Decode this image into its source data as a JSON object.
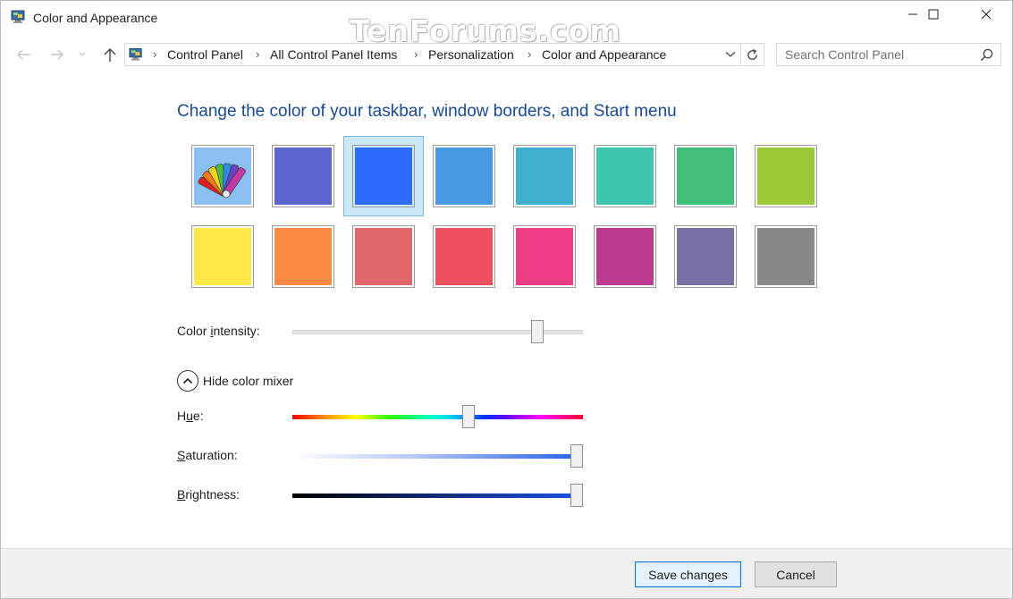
{
  "window": {
    "title": "Color and Appearance",
    "watermark": "TenForums.com"
  },
  "address": {
    "crumbs": [
      "Control Panel",
      "All Control Panel Items",
      "Personalization",
      "Color and Appearance"
    ]
  },
  "search": {
    "placeholder": "Search Control Panel"
  },
  "main": {
    "heading": "Change the color of your taskbar, window borders, and Start menu",
    "swatches_row1": [
      "custom",
      "#5b67cc",
      "#2d6bfa",
      "#4799e4",
      "#41b0d0",
      "#3ec5ab",
      "#42c07a",
      "#9cc93a"
    ],
    "swatches_row2": [
      "#fde846",
      "#fb8a45",
      "#e16669",
      "#ef4e5e",
      "#ee3e87",
      "#bb3a8d",
      "#7c6fa6",
      "#858b84"
    ],
    "selected_swatch_index": 2,
    "intensity": {
      "label_pre": "Color ",
      "label_key": "i",
      "label_post": "ntensity:",
      "value": 0.86
    },
    "mixer_toggle_label": "Hide color mixer",
    "hue": {
      "label_pre": "H",
      "label_key": "u",
      "label_post": "e:",
      "value": 0.61
    },
    "saturation": {
      "label_pre": "",
      "label_key": "S",
      "label_post": "aturation:",
      "value": 1.0
    },
    "brightness": {
      "label_pre": "",
      "label_key": "B",
      "label_post": "rightness:",
      "value": 1.0
    }
  },
  "footer": {
    "save_label": "Save changes",
    "cancel_label": "Cancel"
  },
  "colors": {
    "heading": "#1a4a8e",
    "selected_cell_bg": "#cce8f6",
    "primary_border": "#0078d7"
  }
}
